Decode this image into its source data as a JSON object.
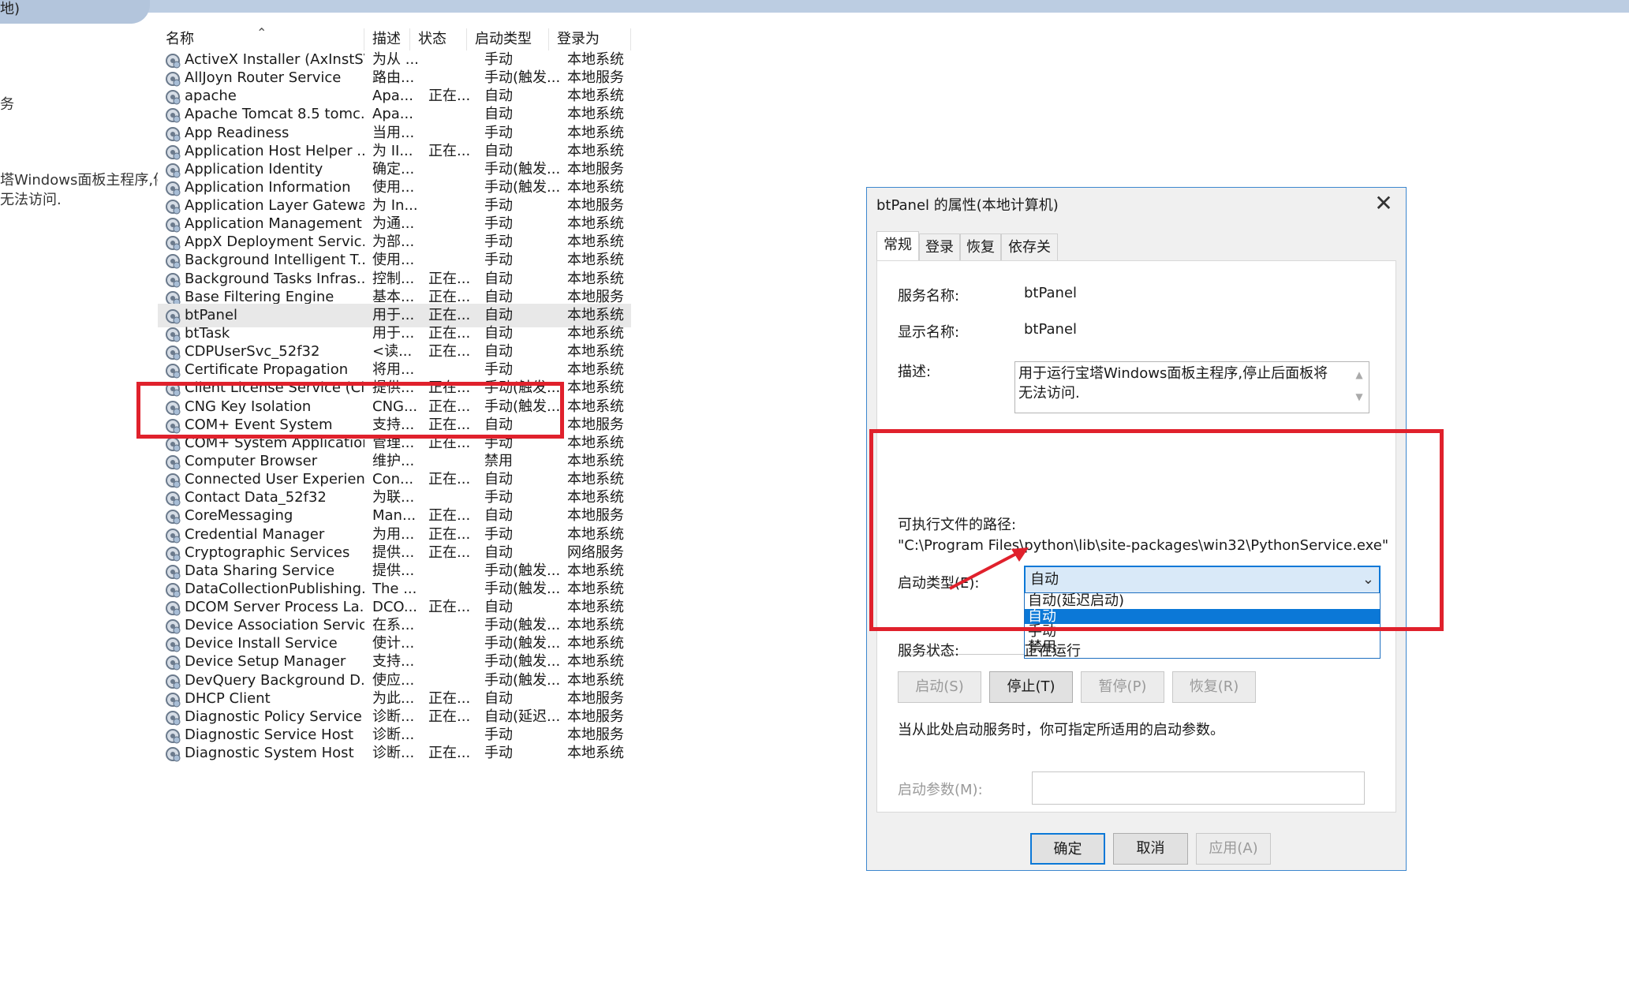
{
  "left_panel": {
    "tab_text": "地)",
    "char": "务",
    "desc_lines": [
      "塔Windows面板主程序,停",
      "无法访问."
    ]
  },
  "list": {
    "headers": {
      "name": "名称",
      "desc": "描述",
      "status": "状态",
      "startup": "启动类型",
      "logon": "登录为"
    },
    "rows": [
      {
        "name": "ActiveX Installer (AxInstSV)",
        "desc": "为从 ...",
        "status": "",
        "startup": "手动",
        "logon": "本地系统"
      },
      {
        "name": "AllJoyn Router Service",
        "desc": "路由...",
        "status": "",
        "startup": "手动(触发...",
        "logon": "本地服务"
      },
      {
        "name": "apache",
        "desc": "Apa...",
        "status": "正在...",
        "startup": "自动",
        "logon": "本地系统"
      },
      {
        "name": "Apache Tomcat 8.5 tomc...",
        "desc": "Apa...",
        "status": "",
        "startup": "自动",
        "logon": "本地系统"
      },
      {
        "name": "App Readiness",
        "desc": "当用...",
        "status": "",
        "startup": "手动",
        "logon": "本地系统"
      },
      {
        "name": "Application Host Helper ...",
        "desc": "为 II...",
        "status": "正在...",
        "startup": "自动",
        "logon": "本地系统"
      },
      {
        "name": "Application Identity",
        "desc": "确定...",
        "status": "",
        "startup": "手动(触发...",
        "logon": "本地服务"
      },
      {
        "name": "Application Information",
        "desc": "使用...",
        "status": "",
        "startup": "手动(触发...",
        "logon": "本地系统"
      },
      {
        "name": "Application Layer Gatewa...",
        "desc": "为 In...",
        "status": "",
        "startup": "手动",
        "logon": "本地服务"
      },
      {
        "name": "Application Management",
        "desc": "为通...",
        "status": "",
        "startup": "手动",
        "logon": "本地系统"
      },
      {
        "name": "AppX Deployment Servic...",
        "desc": "为部...",
        "status": "",
        "startup": "手动",
        "logon": "本地系统"
      },
      {
        "name": "Background Intelligent T...",
        "desc": "使用...",
        "status": "",
        "startup": "手动",
        "logon": "本地系统"
      },
      {
        "name": "Background Tasks Infras...",
        "desc": "控制...",
        "status": "正在...",
        "startup": "自动",
        "logon": "本地系统"
      },
      {
        "name": "Base Filtering Engine",
        "desc": "基本...",
        "status": "正在...",
        "startup": "自动",
        "logon": "本地服务"
      },
      {
        "name": "btPanel",
        "desc": "用于...",
        "status": "正在...",
        "startup": "自动",
        "logon": "本地系统"
      },
      {
        "name": "btTask",
        "desc": "用于...",
        "status": "正在...",
        "startup": "自动",
        "logon": "本地系统"
      },
      {
        "name": "CDPUserSvc_52f32",
        "desc": "<读...",
        "status": "正在...",
        "startup": "自动",
        "logon": "本地系统"
      },
      {
        "name": "Certificate Propagation",
        "desc": "将用...",
        "status": "",
        "startup": "手动",
        "logon": "本地系统"
      },
      {
        "name": "Client License Service (Cli...",
        "desc": "提供...",
        "status": "正在...",
        "startup": "手动(触发...",
        "logon": "本地系统"
      },
      {
        "name": "CNG Key Isolation",
        "desc": "CNG...",
        "status": "正在...",
        "startup": "手动(触发...",
        "logon": "本地系统"
      },
      {
        "name": "COM+ Event System",
        "desc": "支持...",
        "status": "正在...",
        "startup": "自动",
        "logon": "本地服务"
      },
      {
        "name": "COM+ System Application",
        "desc": "管理...",
        "status": "正在...",
        "startup": "手动",
        "logon": "本地系统"
      },
      {
        "name": "Computer Browser",
        "desc": "维护...",
        "status": "",
        "startup": "禁用",
        "logon": "本地系统"
      },
      {
        "name": "Connected User Experien...",
        "desc": "Con...",
        "status": "正在...",
        "startup": "自动",
        "logon": "本地系统"
      },
      {
        "name": "Contact Data_52f32",
        "desc": "为联...",
        "status": "",
        "startup": "手动",
        "logon": "本地系统"
      },
      {
        "name": "CoreMessaging",
        "desc": "Man...",
        "status": "正在...",
        "startup": "自动",
        "logon": "本地服务"
      },
      {
        "name": "Credential Manager",
        "desc": "为用...",
        "status": "正在...",
        "startup": "手动",
        "logon": "本地系统"
      },
      {
        "name": "Cryptographic Services",
        "desc": "提供...",
        "status": "正在...",
        "startup": "自动",
        "logon": "网络服务"
      },
      {
        "name": "Data Sharing Service",
        "desc": "提供...",
        "status": "",
        "startup": "手动(触发...",
        "logon": "本地系统"
      },
      {
        "name": "DataCollectionPublishing...",
        "desc": "The ...",
        "status": "",
        "startup": "手动(触发...",
        "logon": "本地系统"
      },
      {
        "name": "DCOM Server Process La...",
        "desc": "DCO...",
        "status": "正在...",
        "startup": "自动",
        "logon": "本地系统"
      },
      {
        "name": "Device Association Service",
        "desc": "在系...",
        "status": "",
        "startup": "手动(触发...",
        "logon": "本地系统"
      },
      {
        "name": "Device Install Service",
        "desc": "使计...",
        "status": "",
        "startup": "手动(触发...",
        "logon": "本地系统"
      },
      {
        "name": "Device Setup Manager",
        "desc": "支持...",
        "status": "",
        "startup": "手动(触发...",
        "logon": "本地系统"
      },
      {
        "name": "DevQuery Background D...",
        "desc": "使应...",
        "status": "",
        "startup": "手动(触发...",
        "logon": "本地系统"
      },
      {
        "name": "DHCP Client",
        "desc": "为此...",
        "status": "正在...",
        "startup": "自动",
        "logon": "本地服务"
      },
      {
        "name": "Diagnostic Policy Service",
        "desc": "诊断...",
        "status": "正在...",
        "startup": "自动(延迟...",
        "logon": "本地服务"
      },
      {
        "name": "Diagnostic Service Host",
        "desc": "诊断...",
        "status": "",
        "startup": "手动",
        "logon": "本地服务"
      },
      {
        "name": "Diagnostic System Host",
        "desc": "诊断...",
        "status": "正在...",
        "startup": "手动",
        "logon": "本地系统"
      }
    ]
  },
  "dialog": {
    "title": "btPanel 的属性(本地计算机)",
    "close_glyph": "✕",
    "tabs": [
      "常规",
      "登录",
      "恢复",
      "依存关系"
    ],
    "service_name_label": "服务名称:",
    "service_name": "btPanel",
    "display_name_label": "显示名称:",
    "display_name": "btPanel",
    "description_label": "描述:",
    "description": "用于运行宝塔Windows面板主程序,停止后面板将无法访问.",
    "exe_path_label": "可执行文件的路径:",
    "exe_path": "\"C:\\Program Files\\python\\lib\\site-packages\\win32\\PythonService.exe\"",
    "startup_type_label": "启动类型(E):",
    "startup_type_value": "自动",
    "startup_options": [
      "自动(延迟启动)",
      "自动",
      "手动",
      "禁用"
    ],
    "selected_option_index": 1,
    "status_label": "服务状态:",
    "status_value": "正在运行",
    "buttons": {
      "start": "启动(S)",
      "stop": "停止(T)",
      "pause": "暂停(P)",
      "resume": "恢复(R)"
    },
    "hint": "当从此处启动服务时，你可指定所适用的启动参数。",
    "params_label": "启动参数(M):",
    "footer": {
      "ok": "确定",
      "cancel": "取消",
      "apply": "应用(A)"
    }
  },
  "colors": {
    "highlight": "#e0212c",
    "accent": "#0b78d7"
  }
}
